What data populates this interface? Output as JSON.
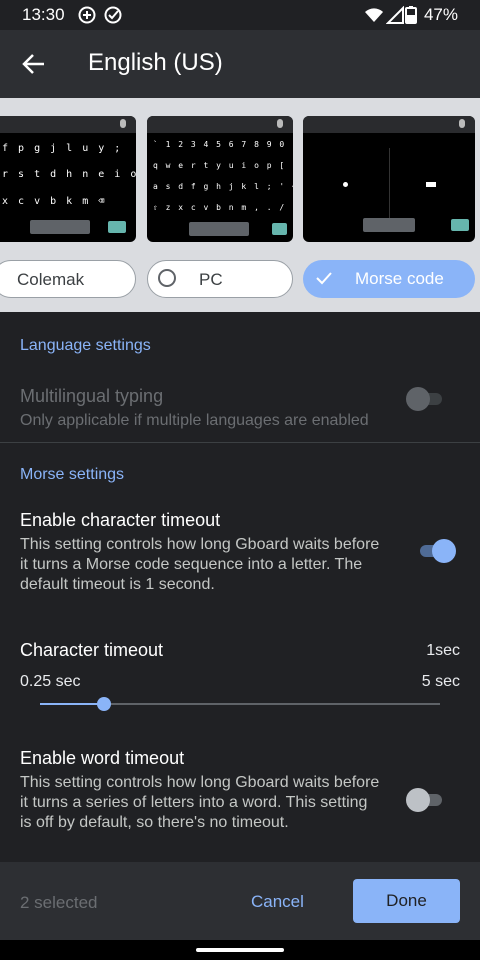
{
  "status_bar": {
    "time": "13:30",
    "battery": "47%"
  },
  "app_bar": {
    "title": "English (US)"
  },
  "layouts": [
    {
      "label": "Colemak",
      "rows": [
        "f p g j l u y ;",
        "r s t d h n e i o",
        "x c v b k m ⌫"
      ]
    },
    {
      "label": "PC",
      "rows": [
        "` 1 2 3 4 5 6 7 8 9 0 - =",
        "q w e r t y u i o p [ ] \\",
        "a s d f g h j k l ; ' ⌫",
        "⇧ z x c v b n m , . / ⇧"
      ]
    },
    {
      "label": "Morse code"
    }
  ],
  "language_settings": {
    "header": "Language settings",
    "multilingual_title": "Multilingual typing",
    "multilingual_sub": "Only applicable if multiple languages are enabled"
  },
  "morse_settings": {
    "header": "Morse settings",
    "char_timeout_title": "Enable character timeout",
    "char_timeout_sub": "This setting controls how long Gboard waits before it turns a Morse code sequence into a letter. The default timeout is 1 second.",
    "char_timeout_label": "Character timeout",
    "char_timeout_value": "1sec",
    "slider_min": "0.25 sec",
    "slider_max": "5 sec",
    "slider_fraction": 0.16,
    "word_timeout_title": "Enable word timeout",
    "word_timeout_sub": "This setting controls how long Gboard waits before it turns a series of letters into a word. This setting is off by default, so there's no timeout."
  },
  "toggles": {
    "multilingual": false,
    "char_timeout": true,
    "word_timeout": false
  },
  "bottom_bar": {
    "selected": "2 selected",
    "cancel": "Cancel",
    "done": "Done"
  },
  "colors": {
    "accent": "#8ab4f8",
    "background": "#202124",
    "surface": "#2d2f33"
  }
}
